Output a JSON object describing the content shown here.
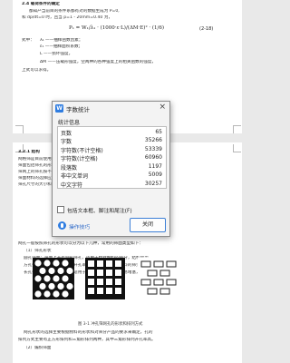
{
  "document": {
    "heading": "2.4 载荷条件的确定",
    "p1_line1": "都知产当前目的条件系都有对的数据生成为 P=0,",
    "p1_line2": "和 dp/dt=0 时，且当 p=1 - 20mm=0.40 为，",
    "equation": "P₁ = W₁/λ₁ · (1000·ε·L)/(ΔM·E)² · (1/6)",
    "equation_number": "(2-18)",
    "where_label": "式中：",
    "var1": "λ₁ ——抽样函数因素；",
    "var2": "ε₁ ——抽样面积系数；",
    "var3": "L ——损坏强度，",
    "var4": "ΔM ——压载形强度，空两种的各种强度上的相关函数的强度，",
    "tail": "上式可以求得。",
    "section2_heading": "3.2.1 结构",
    "p2_lines": [
      "网格筛是目前使用较多的一种筛面，其筛面在筛分过程中起主要作用，",
      "筛面包括筛孔的形状、尺寸和排列方式等，其对筛分效果有重要影响，",
      "筛网上的筛孔按不同的形状可分为方孔、圆孔和长孔等多种形式，",
      "筛面材料的选择应根据物料特性和工作条件确定，常用的有钢丝网等，",
      "筛孔尺寸的大小和开孔率对筛分效率及处理能力有直接的影响。"
    ],
    "p2_more": [
      "网孔一般按照筛孔的形状可以分为以下几种，常用的筛面类型如下：",
      "（1）筛孔形状",
      "圆孔筛面：筛面上开有圆形筛孔，适用于粒状物料的筛分，结构简单，",
      "方孔筛面：筛孔为正方形，开孔率较高，适用于一般物料的筛分作业，",
      "长孔筛面：筛孔为长条形，适用于片状和针状物料，不易堵塞，"
    ],
    "figure_caption": "图 3-1 冲孔筛网孔的形状和排列方式",
    "p3_lines": [
      "网孔形状的选择主要根据物料的形状和对筛分产品的要求来确定，孔的",
      "排列方式主要有正方形排列和三角形排列两种，其中三角形排列开孔率高。",
      "（2）编织筛面"
    ]
  },
  "dialog": {
    "title": "字数统计",
    "app_icon_letter": "W",
    "close_glyph": "×",
    "group_label": "统计信息",
    "rows": [
      {
        "label": "页数",
        "value": "65"
      },
      {
        "label": "字数",
        "value": "35266"
      },
      {
        "label": "字符数(不计空格)",
        "value": "53339"
      },
      {
        "label": "字符数(计空格)",
        "value": "60960"
      },
      {
        "label": "段落数",
        "value": "1197"
      },
      {
        "label": "非中文单词",
        "value": "5009"
      },
      {
        "label": "中文字符",
        "value": "30257"
      }
    ],
    "include_footnotes_label": "包括文本框、脚注和尾注(F)",
    "include_footnotes_checked": false,
    "tips_label": "操作技巧",
    "close_button_label": "关闭"
  },
  "colors": {
    "accent": "#2f7de1",
    "page_bg": "#ffffff",
    "canvas_bg": "#e9e9e9"
  }
}
